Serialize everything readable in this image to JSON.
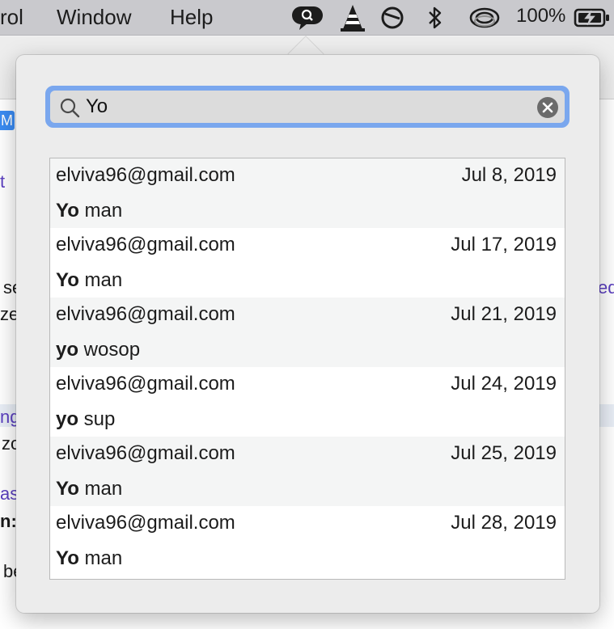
{
  "menubar": {
    "items": [
      "rol",
      "Window",
      "Help"
    ],
    "battery": "100%",
    "icons": [
      "search-chat-icon",
      "vlc-cone-icon",
      "circle-slash-icon",
      "bluetooth-icon",
      "wifi-icon",
      "battery-icon"
    ]
  },
  "background": {
    "badge": "M",
    "fragments": [
      "t",
      "se",
      "ze",
      "ed",
      "ng",
      "zo",
      "as",
      "n:",
      "be"
    ]
  },
  "search": {
    "value": "Yo",
    "placeholder": ""
  },
  "results": [
    {
      "from": "elviva96@gmail.com",
      "date": "Jul 8, 2019",
      "subject_match": "Yo",
      "subject_rest": " man"
    },
    {
      "from": "elviva96@gmail.com",
      "date": "Jul 17, 2019",
      "subject_match": "Yo",
      "subject_rest": " man"
    },
    {
      "from": "elviva96@gmail.com",
      "date": "Jul 21, 2019",
      "subject_match": "yo",
      "subject_rest": " wosop"
    },
    {
      "from": "elviva96@gmail.com",
      "date": "Jul 24, 2019",
      "subject_match": "yo",
      "subject_rest": " sup"
    },
    {
      "from": "elviva96@gmail.com",
      "date": "Jul 25, 2019",
      "subject_match": "Yo",
      "subject_rest": " man"
    },
    {
      "from": "elviva96@gmail.com",
      "date": "Jul 28, 2019",
      "subject_match": "Yo",
      "subject_rest": " man"
    }
  ],
  "colors": {
    "accent": "#7aa7ee",
    "row_alt": "#f4f5f5"
  }
}
